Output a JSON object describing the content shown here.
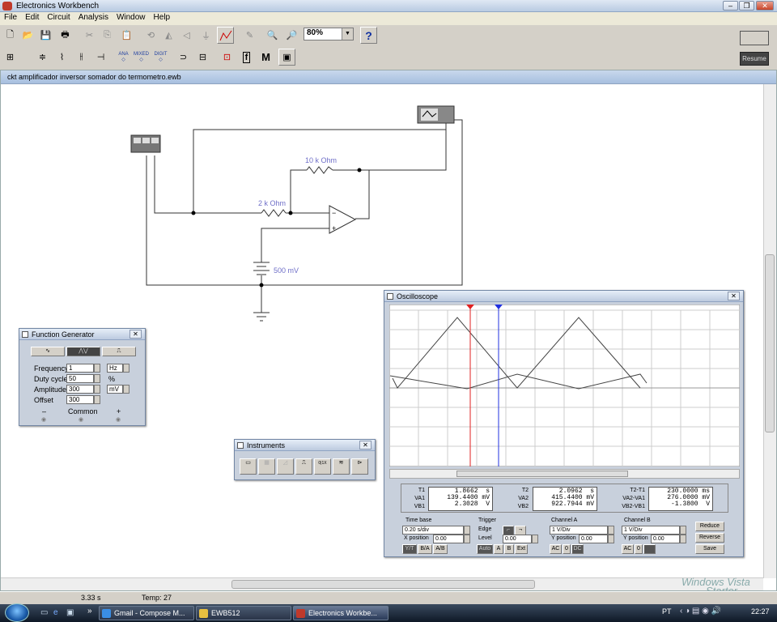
{
  "window": {
    "title": "Electronics Workbench",
    "min": "–",
    "max": "❐",
    "close": "✕"
  },
  "menu": [
    "File",
    "Edit",
    "Circuit",
    "Analysis",
    "Window",
    "Help"
  ],
  "toolbar": {
    "zoom": "80%",
    "zoom_arrow": "▼",
    "help": "?",
    "resume": "Resume",
    "ana": "ANA",
    "mixed": "MIXED",
    "digit": "DIGIT",
    "f_btn": "f",
    "m_btn": "M"
  },
  "circuit": {
    "filename": "ckt amplificador inversor somador do termometro.ewb",
    "r1": "10 k Ohm",
    "r2": "2 k Ohm",
    "battery": "500 mV"
  },
  "function_generator": {
    "title": "Function Generator",
    "rows": [
      {
        "label": "Frequency",
        "value": "1",
        "unit": "Hz"
      },
      {
        "label": "Duty cycle",
        "value": "50",
        "unit": "%"
      },
      {
        "label": "Amplitude",
        "value": "300",
        "unit": "mV"
      },
      {
        "label": "Offset",
        "value": "300",
        "unit": ""
      }
    ],
    "minus": "–",
    "common": "Common",
    "plus": "+"
  },
  "instruments": {
    "title": "Instruments",
    "tool_label": "0|1X"
  },
  "oscilloscope": {
    "title": "Oscilloscope",
    "readouts": [
      {
        "labels": [
          "T1",
          "VA1",
          "VB1"
        ],
        "values": [
          "1.8662  s",
          "139.4400 mV",
          "2.3028  V"
        ]
      },
      {
        "labels": [
          "T2",
          "VA2",
          "VB2"
        ],
        "values": [
          "2.0962  s",
          "415.4400 mV",
          "922.7944 mV"
        ]
      },
      {
        "labels": [
          "T2-T1",
          "VA2-VA1",
          "VB2-VB1"
        ],
        "values": [
          "230.0000 ms",
          "276.0000 mV",
          "-1.3800  V"
        ]
      }
    ],
    "timebase": {
      "title": "Time base",
      "value": "0.20 s/div",
      "xpos_label": "X position",
      "xpos": "0.00",
      "modes": [
        "Y/T",
        "B/A",
        "A/B"
      ]
    },
    "trigger": {
      "title": "Trigger",
      "edge": "Edge",
      "level_label": "Level",
      "level": "0.00",
      "buttons": [
        "Auto",
        "A",
        "B",
        "Ext"
      ]
    },
    "channel_a": {
      "title": "Channel A",
      "value": "1  V/Div",
      "ypos_label": "Y position",
      "ypos": "0.00",
      "buttons": [
        "AC",
        "0",
        "DC"
      ]
    },
    "channel_b": {
      "title": "Channel B",
      "value": "1  V/Div",
      "ypos_label": "Y position",
      "ypos": "0.00",
      "buttons": [
        "AC",
        "0",
        "DC"
      ]
    },
    "actions": [
      "Reduce",
      "Reverse",
      "Save"
    ]
  },
  "status": {
    "time": "3.33 s",
    "temp": "Temp:  27"
  },
  "watermark": {
    "line1": "Windows Vista",
    "line2": "Starter"
  },
  "taskbar": {
    "tasks": [
      "Gmail - Compose M...",
      "EWB512",
      "Electronics Workbe..."
    ],
    "lang": "PT",
    "clock": "22:27",
    "more": "»"
  }
}
